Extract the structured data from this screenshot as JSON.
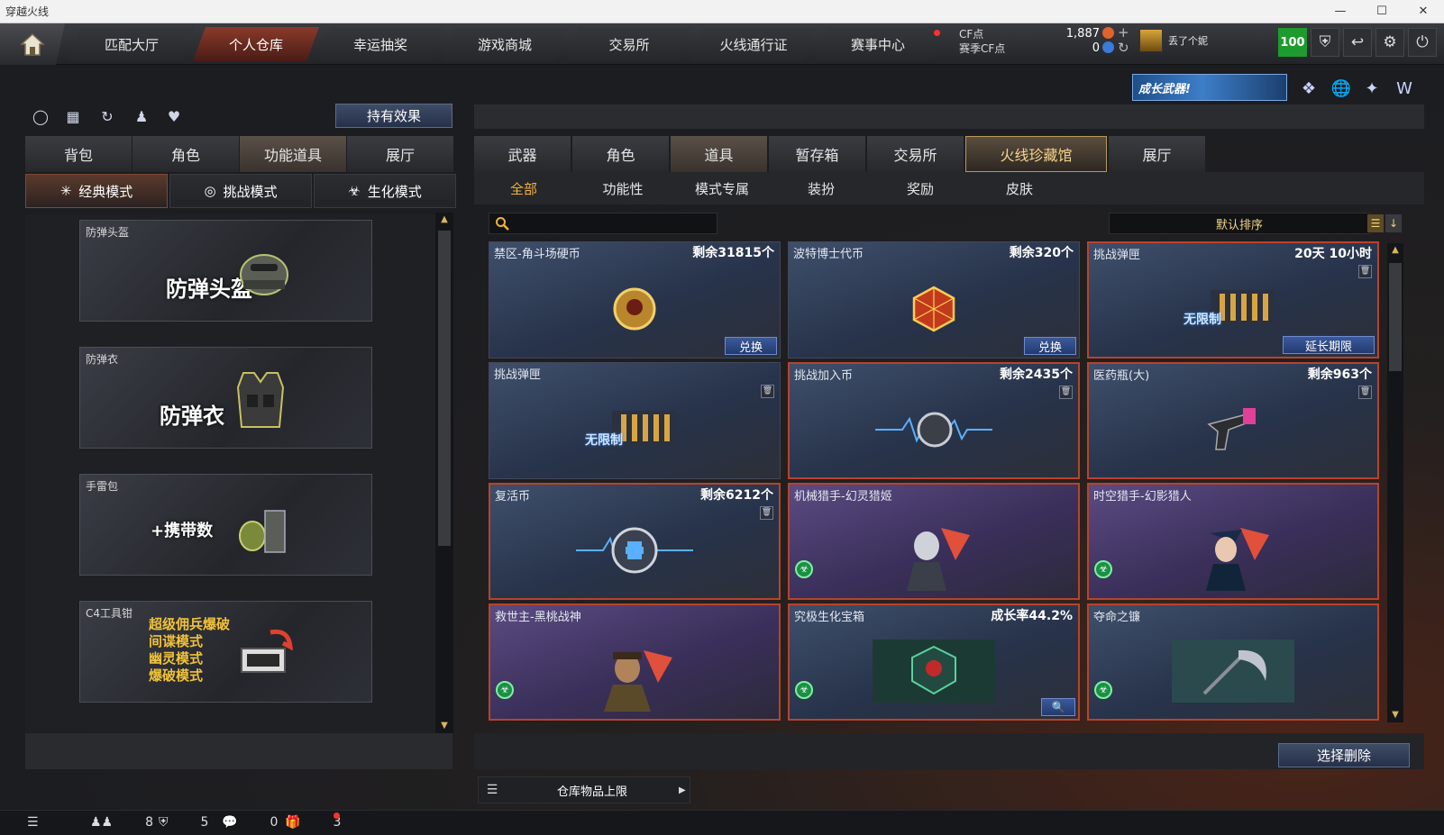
{
  "window": {
    "title": "穿越火线"
  },
  "topnav": {
    "tabs": [
      {
        "label": "匹配大厅",
        "active": false
      },
      {
        "label": "个人仓库",
        "active": true
      },
      {
        "label": "幸运抽奖",
        "active": false
      },
      {
        "label": "游戏商城",
        "active": false
      },
      {
        "label": "交易所",
        "active": false
      },
      {
        "label": "火线通行证",
        "active": false
      },
      {
        "label": "赛事中心",
        "active": false
      }
    ],
    "cf_label": "CF点",
    "season_cf_label": "赛季CF点",
    "cf_value": "1,887",
    "season_cf_value": "0",
    "username": "丢了个妮",
    "level": "100"
  },
  "promo": {
    "text": "成长武器!"
  },
  "left": {
    "hold_effect_label": "持有效果",
    "tabs": [
      {
        "label": "背包",
        "active": false
      },
      {
        "label": "角色",
        "active": false
      },
      {
        "label": "功能道具",
        "active": true
      },
      {
        "label": "展厅",
        "active": false
      }
    ],
    "modes": [
      {
        "label": "经典模式",
        "active": true
      },
      {
        "label": "挑战模式",
        "active": false
      },
      {
        "label": "生化模式",
        "active": false
      }
    ],
    "equipment": [
      {
        "label": "防弹头盔",
        "big": "防弹头盔"
      },
      {
        "label": "防弹衣",
        "big": "防弹衣"
      },
      {
        "label": "手雷包",
        "big": "+携带数"
      },
      {
        "label": "C4工具钳",
        "modes": [
          "超级佣兵爆破",
          "间谍模式",
          "幽灵模式",
          "爆破模式"
        ]
      }
    ]
  },
  "right": {
    "tabs": [
      {
        "label": "武器",
        "active": false
      },
      {
        "label": "角色",
        "active": false
      },
      {
        "label": "道具",
        "active": true
      },
      {
        "label": "暂存箱",
        "active": false
      },
      {
        "label": "交易所",
        "active": false
      },
      {
        "label": "火线珍藏馆",
        "active": false
      },
      {
        "label": "展厅",
        "active": false
      }
    ],
    "subtabs": [
      {
        "label": "全部",
        "active": true
      },
      {
        "label": "功能性",
        "active": false
      },
      {
        "label": "模式专属",
        "active": false
      },
      {
        "label": "装扮",
        "active": false
      },
      {
        "label": "奖励",
        "active": false
      },
      {
        "label": "皮肤",
        "active": false
      }
    ],
    "search_value": "",
    "sort_label": "默认排序",
    "items": [
      {
        "name": "禁区-角斗场硬币",
        "info": "剩余31815个",
        "button": "兑换"
      },
      {
        "name": "波特博士代币",
        "info": "剩余320个",
        "button": "兑换"
      },
      {
        "name": "挑战弹匣",
        "info": "20天 10小时",
        "button": "延长期限",
        "art_text": "无限制"
      },
      {
        "name": "挑战弹匣",
        "info": "",
        "art_text": "无限制"
      },
      {
        "name": "挑战加入币",
        "info": "剩余2435个"
      },
      {
        "name": "医药瓶(大)",
        "info": "剩余963个"
      },
      {
        "name": "复活币",
        "info": "剩余6212个"
      },
      {
        "name": "机械猎手-幻灵猎姬",
        "info": ""
      },
      {
        "name": "时空猎手-幻影猎人",
        "info": ""
      },
      {
        "name": "救世主-黑桃战神",
        "info": ""
      },
      {
        "name": "究极生化宝箱",
        "info": "成长率44.2%"
      },
      {
        "name": "夺命之镰",
        "info": ""
      }
    ],
    "select_delete_label": "选择删除",
    "capacity_label": "仓库物品上限"
  },
  "statusbar": {
    "friends": "8",
    "clan": "5",
    "messages": "0",
    "gifts": "3"
  },
  "colors": {
    "accent": "#f0b23a",
    "active_tab": "#8a3a2a",
    "red_border": "#b8432d"
  }
}
